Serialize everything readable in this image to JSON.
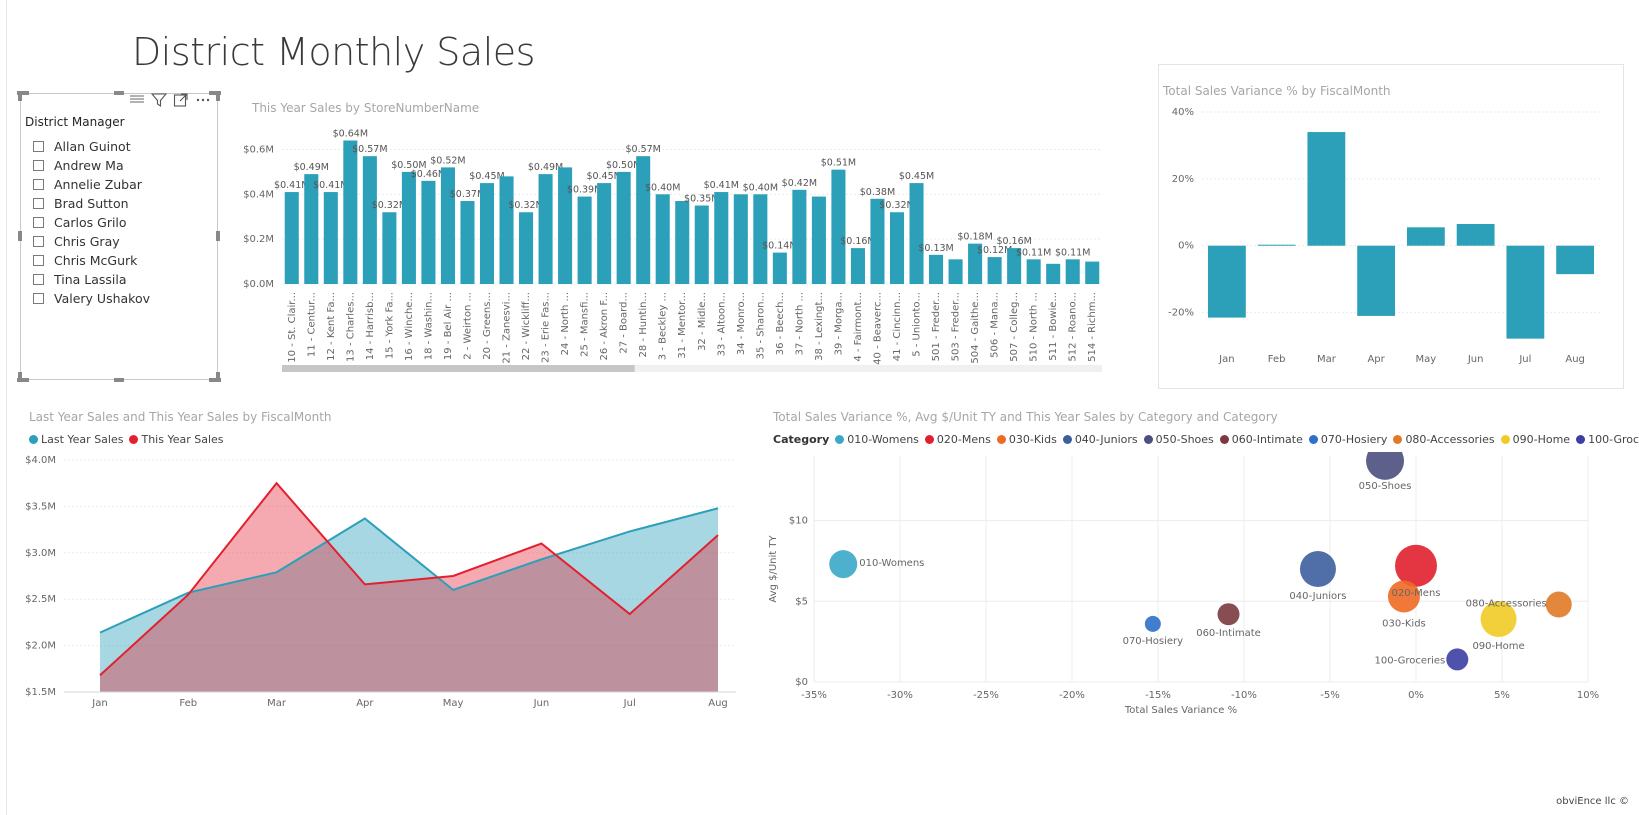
{
  "title": "District Monthly Sales",
  "slicer": {
    "title": "District Manager",
    "items": [
      "Allan Guinot",
      "Andrew Ma",
      "Annelie Zubar",
      "Brad Sutton",
      "Carlos Grilo",
      "Chris Gray",
      "Chris McGurk",
      "Tina Lassila",
      "Valery Ushakov"
    ],
    "toolbar": {
      "focus_icon": "focus-mode-icon",
      "filter_icon": "filter-icon",
      "more_icon": "more-options-icon",
      "drag_icon": "drag-handle-icon"
    }
  },
  "footer": "obviEnce llc ©",
  "colors": {
    "teal": "#2c9fb9",
    "red": "#e3202f",
    "grid": "#ececec"
  },
  "chart_data": [
    {
      "id": "store_bar",
      "type": "bar",
      "title": "This Year Sales by StoreNumberName",
      "categories": [
        "10 - St. Clair...",
        "11 - Centur...",
        "12 - Kent Fa...",
        "13 - Charles...",
        "14 - Harrisb...",
        "15 - York Fa...",
        "16 - Winche...",
        "18 - Washin...",
        "19 - Bel Air ...",
        "2 - Weirton ...",
        "20 - Greens...",
        "21 - Zanesvi...",
        "22 - Wickliff...",
        "23 - Erie Fas...",
        "24 - North ...",
        "25 - Mansfi...",
        "26 - Akron F...",
        "27 - Board...",
        "28 - Huntin...",
        "3 - Beckley ...",
        "31 - Mentor...",
        "32 - Midle...",
        "33 - Altoon...",
        "34 - Monro...",
        "35 - Sharon...",
        "36 - Beech...",
        "37 - North ...",
        "38 - Lexingt...",
        "39 - Morga...",
        "4 - Fairmont...",
        "40 - Beaverc...",
        "41 - Cincinn...",
        "5 - Uniontо...",
        "501 - Freder...",
        "503 - Freder...",
        "504 - Gaithe...",
        "506 - Mana...",
        "507 - Colleg...",
        "510 - North ...",
        "511 - Bowie...",
        "512 - Roano...",
        "514 - Richm..."
      ],
      "values": [
        0.41,
        0.49,
        0.41,
        0.64,
        0.57,
        0.32,
        0.5,
        0.46,
        0.52,
        0.37,
        0.45,
        0.48,
        0.32,
        0.49,
        0.52,
        0.39,
        0.45,
        0.5,
        0.57,
        0.4,
        0.37,
        0.35,
        0.41,
        0.4,
        0.4,
        0.14,
        0.42,
        0.39,
        0.51,
        0.16,
        0.38,
        0.32,
        0.45,
        0.13,
        0.11,
        0.18,
        0.12,
        0.16,
        0.11,
        0.09,
        0.11,
        0.1
      ],
      "data_labels": [
        "$0.41M",
        "$0.49M",
        "$0.41M",
        "$0.64M",
        "$0.57M",
        "$0.32M",
        "$0.50M",
        "$0.46M",
        "$0.52M",
        "$0.37M",
        "$0.45M",
        "",
        "$0.32M",
        "$0.49M",
        "",
        "$0.39M",
        "$0.45M",
        "$0.50M",
        "$0.57M",
        "$0.40M",
        "",
        "$0.35M",
        "$0.41M",
        "",
        "$0.40M",
        "$0.14M",
        "$0.42M",
        "",
        "$0.51M",
        "$0.16M",
        "$0.38M",
        "$0.32M",
        "$0.45M",
        "$0.13M",
        "",
        "$0.18M",
        "$0.12M",
        "$0.16M",
        "$0.11M",
        "",
        "$0.11M",
        ""
      ],
      "yticks": [
        "$0.0M",
        "$0.2M",
        "$0.4M",
        "$0.6M"
      ],
      "ylim": [
        0,
        0.66
      ],
      "unit": "$M",
      "scrollbar_fraction_visible": 0.43
    },
    {
      "id": "variance_bar",
      "type": "bar",
      "title": "Total Sales Variance % by FiscalMonth",
      "categories": [
        "Jan",
        "Feb",
        "Mar",
        "Apr",
        "May",
        "Jun",
        "Jul",
        "Aug"
      ],
      "values": [
        -21.5,
        0.3,
        34.0,
        -21.0,
        5.5,
        6.5,
        -27.8,
        -8.5
      ],
      "yticks": [
        "-20%",
        "0%",
        "20%",
        "40%"
      ],
      "ylim": [
        -30,
        40
      ]
    },
    {
      "id": "area_chart",
      "type": "area",
      "title": "Last Year Sales and This Year Sales by FiscalMonth",
      "x": [
        "Jan",
        "Feb",
        "Mar",
        "Apr",
        "May",
        "Jun",
        "Jul",
        "Aug"
      ],
      "series": [
        {
          "name": "Last Year Sales",
          "values": [
            2.14,
            2.57,
            2.79,
            3.37,
            2.6,
            2.93,
            3.23,
            3.48
          ]
        },
        {
          "name": "This Year Sales",
          "values": [
            1.68,
            2.55,
            3.75,
            2.66,
            2.75,
            3.1,
            2.34,
            3.19
          ]
        }
      ],
      "yticks": [
        "$1.5M",
        "$2.0M",
        "$2.5M",
        "$3.0M",
        "$3.5M",
        "$4.0M"
      ],
      "ylim": [
        1.5,
        4.0
      ]
    },
    {
      "id": "bubble_chart",
      "type": "scatter",
      "title": "Total Sales Variance %, Avg $/Unit TY and This Year Sales by Category and Category",
      "legend_title": "Category",
      "xlabel": "Total Sales Variance %",
      "ylabel": "Avg $/Unit TY",
      "xticks": [
        "-35%",
        "-30%",
        "-25%",
        "-20%",
        "-15%",
        "-10%",
        "-5%",
        "0%",
        "5%",
        "10%"
      ],
      "yticks": [
        "$0",
        "$5",
        "$10"
      ],
      "xlim": [
        -35,
        10
      ],
      "ylim": [
        0,
        14
      ],
      "points": [
        {
          "name": "010-Womens",
          "x": -33.3,
          "y": 7.3,
          "r": 14,
          "color": "#3aa8c9"
        },
        {
          "name": "020-Mens",
          "x": 0.0,
          "y": 7.2,
          "r": 21,
          "color": "#e0202e"
        },
        {
          "name": "030-Kids",
          "x": -0.7,
          "y": 5.3,
          "r": 16,
          "color": "#ee6a25"
        },
        {
          "name": "040-Juniors",
          "x": -5.7,
          "y": 7.0,
          "r": 18,
          "color": "#3d5f9e"
        },
        {
          "name": "050-Shoes",
          "x": -1.8,
          "y": 13.7,
          "r": 19,
          "color": "#4c4f80"
        },
        {
          "name": "060-Intimate",
          "x": -10.9,
          "y": 4.2,
          "r": 11,
          "color": "#7b3a40"
        },
        {
          "name": "070-Hosiery",
          "x": -15.3,
          "y": 3.6,
          "r": 8,
          "color": "#2e6fc9"
        },
        {
          "name": "080-Accessories",
          "x": 8.3,
          "y": 4.8,
          "r": 13,
          "color": "#e07a28"
        },
        {
          "name": "090-Home",
          "x": 4.8,
          "y": 3.9,
          "r": 18,
          "color": "#efcb26"
        },
        {
          "name": "100-Groceries",
          "x": 2.4,
          "y": 1.4,
          "r": 11,
          "color": "#3b3fa3"
        }
      ]
    }
  ]
}
